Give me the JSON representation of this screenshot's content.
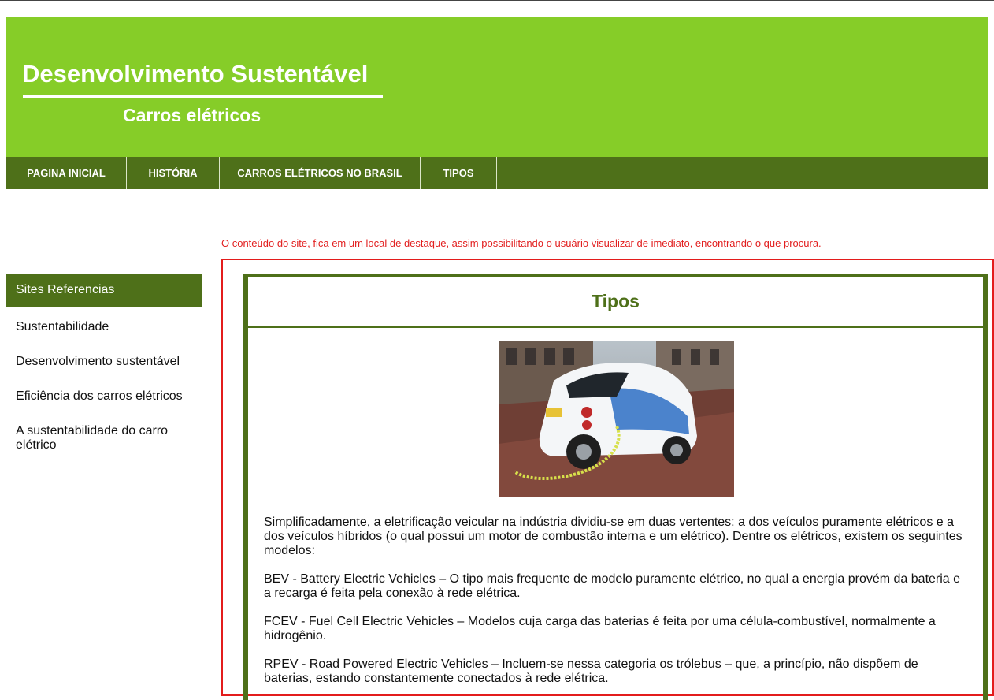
{
  "header": {
    "title": "Desenvolvimento Sustentável",
    "subtitle": "Carros elétricos",
    "background_color": "#86cd28"
  },
  "nav": {
    "items": [
      {
        "label": "PAGINA INICIAL"
      },
      {
        "label": "HISTÓRIA"
      },
      {
        "label": "CARROS ELÉTRICOS NO BRASIL"
      },
      {
        "label": "TIPOS"
      }
    ],
    "background_color": "#4e7019"
  },
  "notice": {
    "text": "O conteúdo do site, fica em um local de destaque, assim possibilitando o usuário visualizar de imediato, encontrando o que procura.",
    "color": "#e21f1f"
  },
  "sidebar": {
    "heading": "Sites Referencias",
    "links": [
      {
        "label": "Sustentabilidade"
      },
      {
        "label": "Desenvolvimento sustentável"
      },
      {
        "label": "Eficiência dos carros elétricos"
      },
      {
        "label": "A sustentabilidade do carro elétrico"
      }
    ]
  },
  "main": {
    "title": "Tipos",
    "image_alt": "electric car charging",
    "paragraphs": [
      "Simplificadamente, a eletrificação veicular na indústria dividiu-se em duas vertentes: a dos veículos puramente elétricos e a dos veículos híbridos (o qual possui um motor de combustão interna e um elétrico). Dentre os elétricos, existem os seguintes modelos:",
      "BEV - Battery Electric Vehicles – O tipo mais frequente de modelo puramente elétrico, no qual a energia provém da bateria e a recarga é feita pela conexão à rede elétrica.",
      "FCEV - Fuel Cell Electric Vehicles – Modelos cuja carga das baterias é feita por uma célula-combustível, normalmente a hidrogênio.",
      "RPEV - Road Powered Electric Vehicles – Incluem-se nessa categoria os trólebus – que, a princípio, não dispõem de baterias, estando constantemente conectados à rede elétrica."
    ],
    "accent_color": "#4e7019",
    "highlight_border_color": "#e31c1c"
  }
}
